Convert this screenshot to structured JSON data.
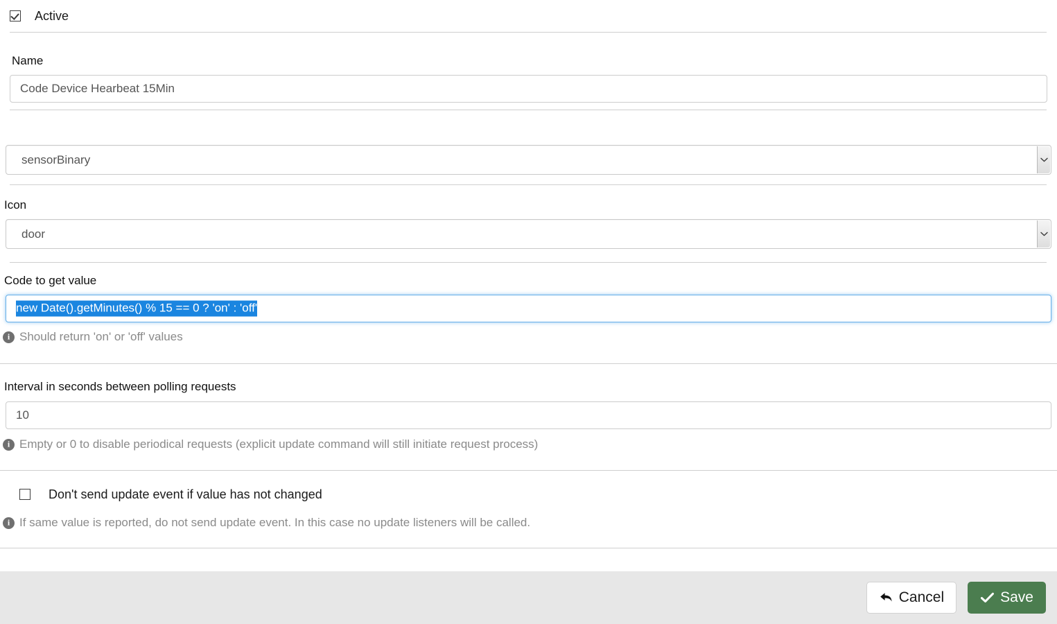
{
  "form": {
    "active": {
      "label": "Active",
      "checked": true
    },
    "name": {
      "label": "Name",
      "value": "Code Device Hearbeat 15Min",
      "placeholder": "Name"
    },
    "device_type": {
      "label": "",
      "value": "sensorBinary",
      "options": [
        "sensorBinary"
      ]
    },
    "icon": {
      "label": "Icon",
      "value": "door",
      "options": [
        "door"
      ]
    },
    "code": {
      "label": "Code to get value",
      "value": "new Date().getMinutes() % 15 == 0 ? 'on' : 'off'",
      "selected": true,
      "help": "Should return 'on' or 'off' values"
    },
    "interval": {
      "label": "Interval in seconds between polling requests",
      "value": "10",
      "help": "Empty or 0 to disable periodical requests (explicit update command will still initiate request process)"
    },
    "skip_unchanged": {
      "label": "Don't send update event if value has not changed",
      "checked": false,
      "help": "If same value is reported, do not send update event. In this case no update listeners will be called."
    }
  },
  "footer": {
    "cancel_label": "Cancel",
    "save_label": "Save"
  },
  "colors": {
    "selection_blue": "#1a85e0",
    "focus_border": "#66afe9",
    "save_green": "#4b7d4f",
    "footer_bg": "#e7e7e7",
    "divider": "#cfcfcf",
    "help_text": "#8a8a8a"
  },
  "icons": {
    "info": "info-icon",
    "chevron_down": "chevron-down-icon",
    "back_arrow": "back-arrow-icon",
    "check": "check-icon"
  }
}
